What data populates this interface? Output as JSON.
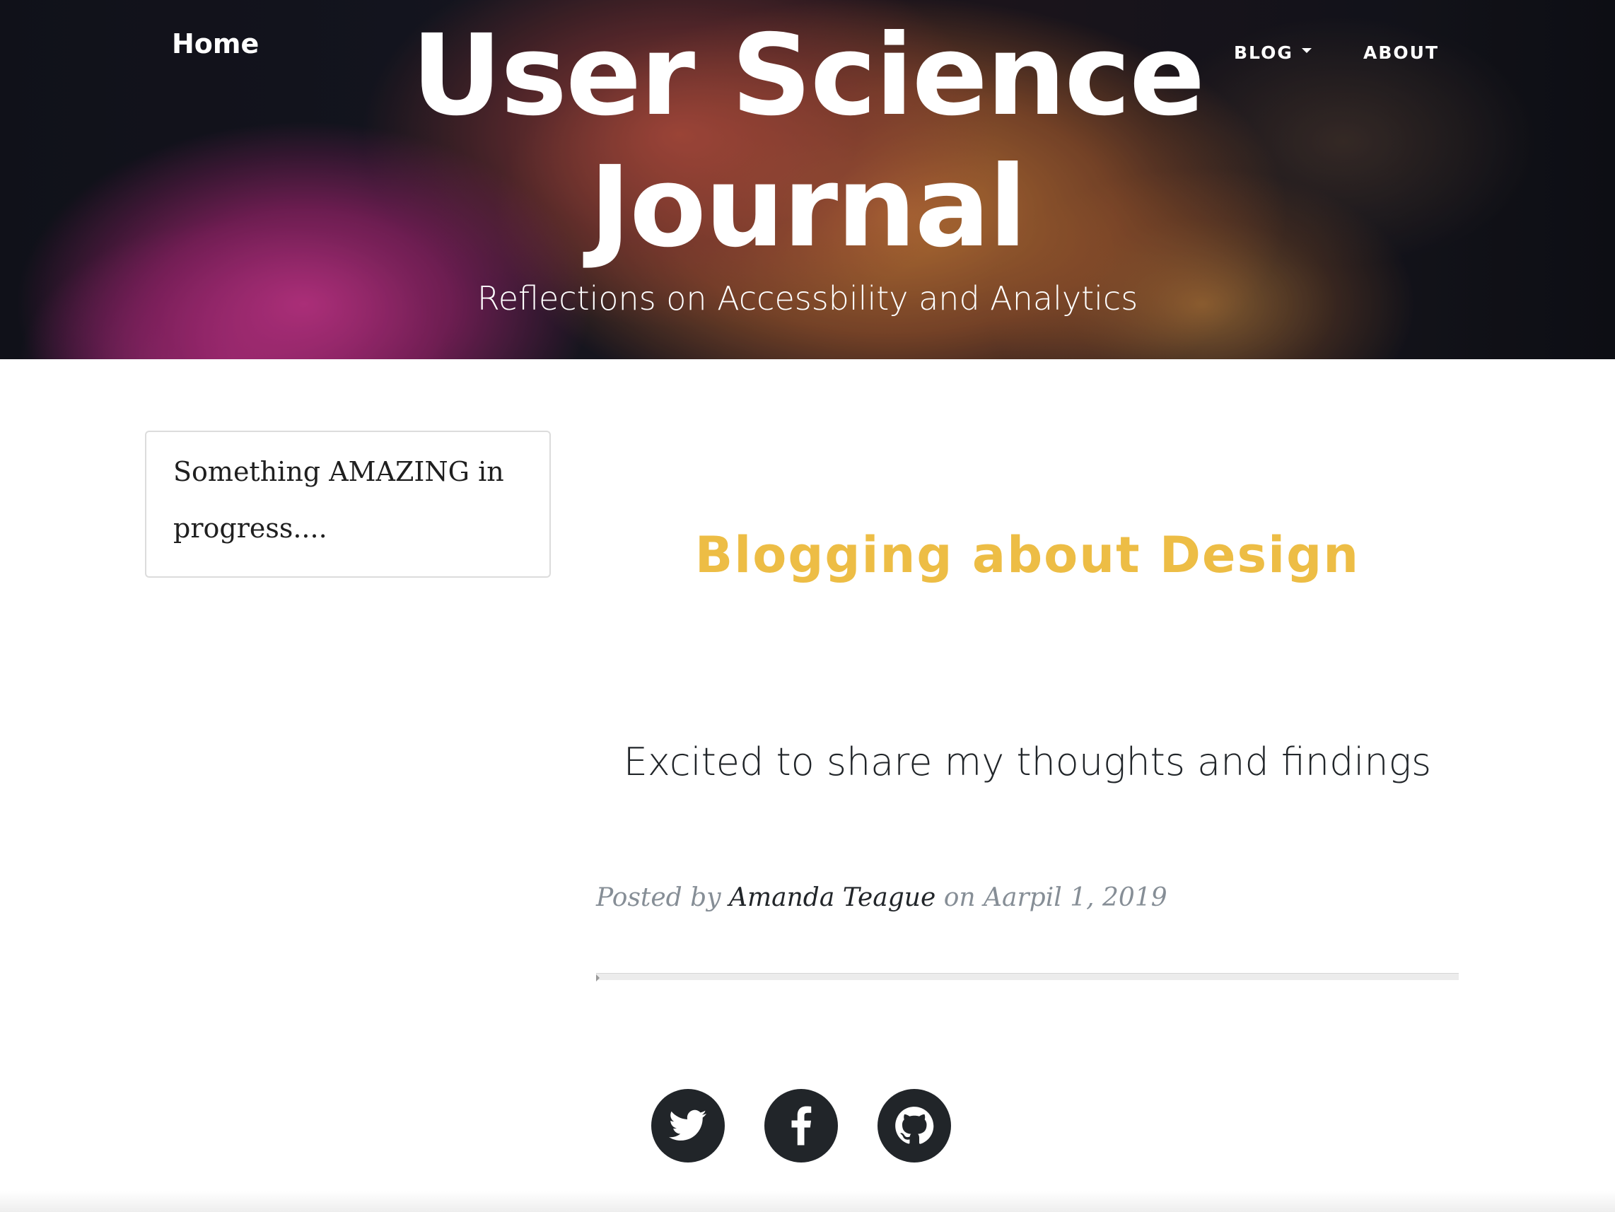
{
  "nav": {
    "brand": "Home",
    "blog_label": "BLOG",
    "about_label": "ABOUT"
  },
  "header": {
    "title_line1": "User Science",
    "title_line2": "Journal",
    "subtitle": "Reflections on Accessbility and Analytics"
  },
  "sidebar": {
    "text": "Something AMAZING in progress...."
  },
  "post": {
    "title": "Blogging about Design",
    "subtitle": "Excited to share my thoughts and findings",
    "meta_prefix": "Posted by ",
    "author": "Amanda Teague",
    "meta_on": " on ",
    "date": "Aarpil 1, 2019"
  },
  "social": [
    {
      "icon": "twitter-icon"
    },
    {
      "icon": "facebook-icon"
    },
    {
      "icon": "github-icon"
    }
  ],
  "colors": {
    "post_title": "#edbd45",
    "text": "#212529",
    "muted": "#868e96",
    "social_bg": "#212529"
  }
}
